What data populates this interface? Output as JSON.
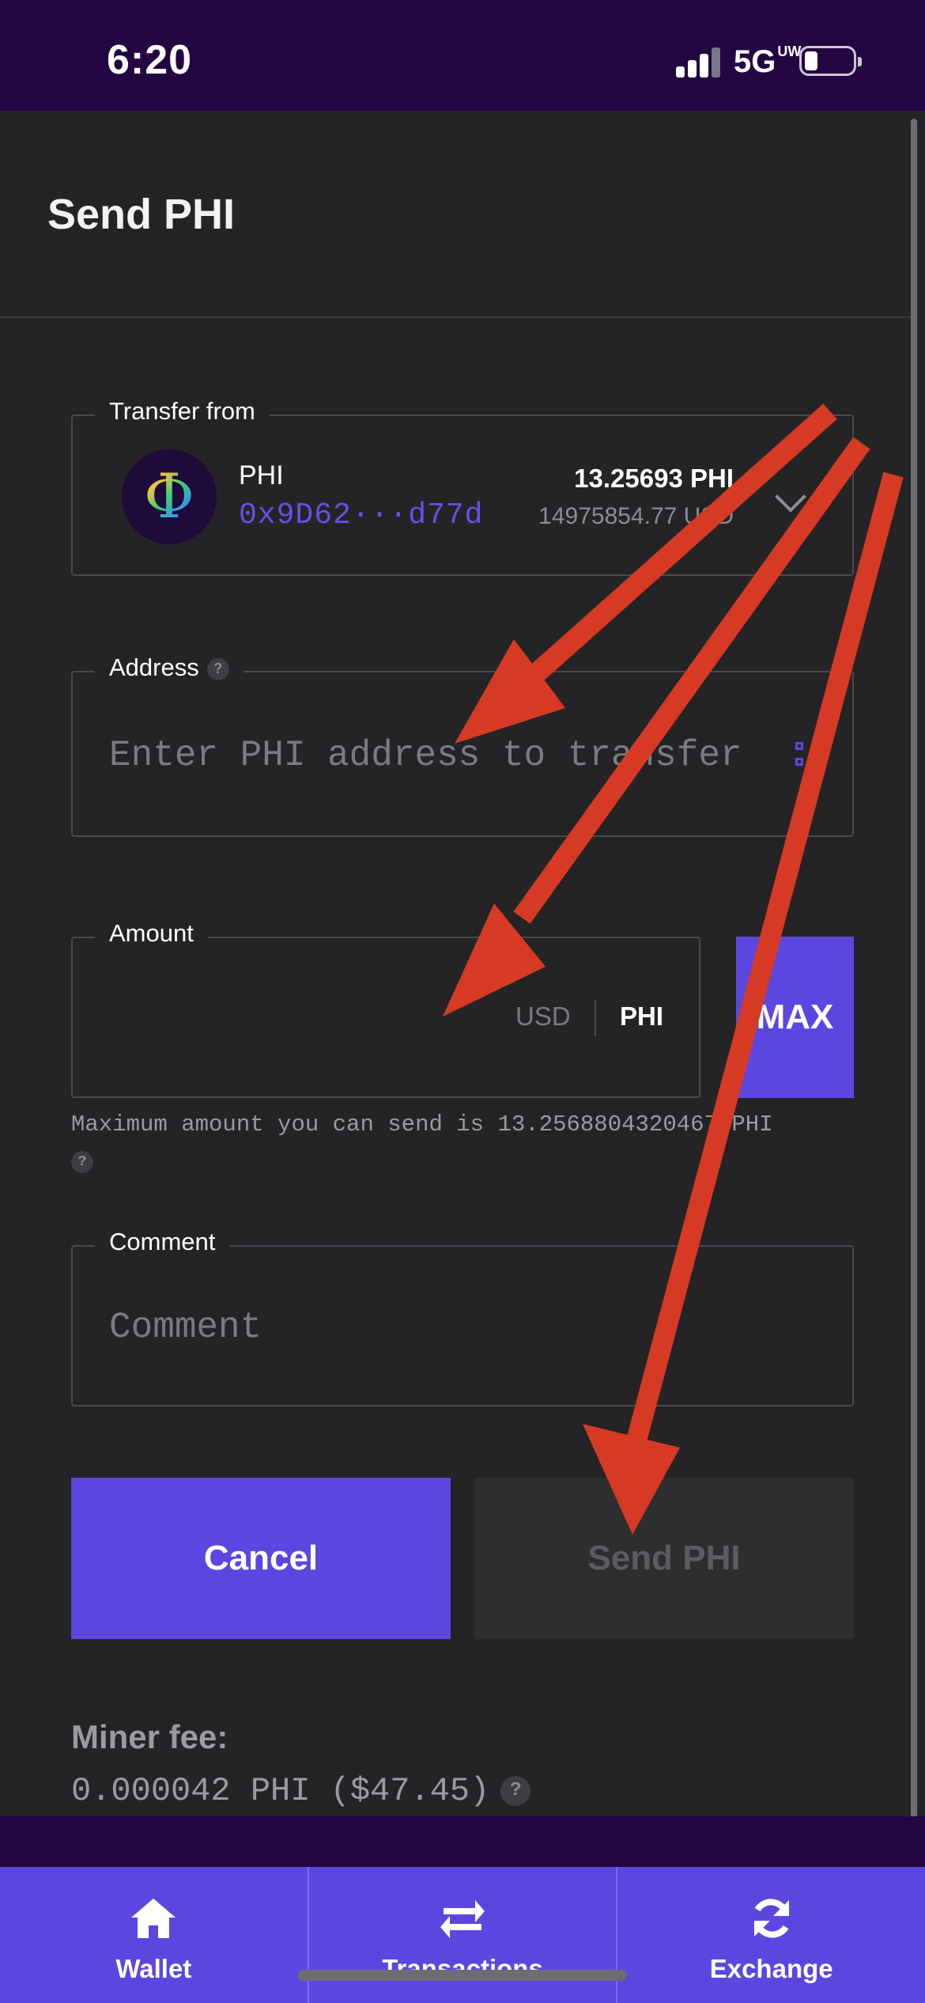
{
  "status_bar": {
    "time": "6:20",
    "network": "5G",
    "network_sub": "UW"
  },
  "header": {
    "title": "Send PHI"
  },
  "transfer_from": {
    "legend": "Transfer from",
    "coin_name": "PHI",
    "address": "0x9D62···d77d",
    "balance": "13.25693 PHI",
    "balance_usd": "14975854.77 USD",
    "logo_glyph": "Φ"
  },
  "address_field": {
    "legend": "Address",
    "help": "?",
    "placeholder": "Enter PHI address to transfer"
  },
  "amount_field": {
    "legend": "Amount",
    "value": "",
    "unit_usd": "USD",
    "unit_phi": "PHI",
    "max_label": "MAX",
    "max_note": "Maximum amount you can send is 13.2568804320467 PHI",
    "help": "?"
  },
  "comment_field": {
    "legend": "Comment",
    "placeholder": "Comment"
  },
  "actions": {
    "cancel_label": "Cancel",
    "send_label": "Send PHI"
  },
  "miner_fee": {
    "label": "Miner fee:",
    "value": "0.000042 PHI ($47.45)",
    "help": "?"
  },
  "bottom_nav": {
    "items": [
      {
        "label": "Wallet",
        "icon": "home-icon"
      },
      {
        "label": "Transactions",
        "icon": "swap-arrows-icon"
      },
      {
        "label": "Exchange",
        "icon": "refresh-icon"
      }
    ]
  },
  "colors": {
    "accent": "#5b47e0",
    "background": "#242426",
    "status_bar": "#230541",
    "annotation_arrow": "#d63a24"
  }
}
